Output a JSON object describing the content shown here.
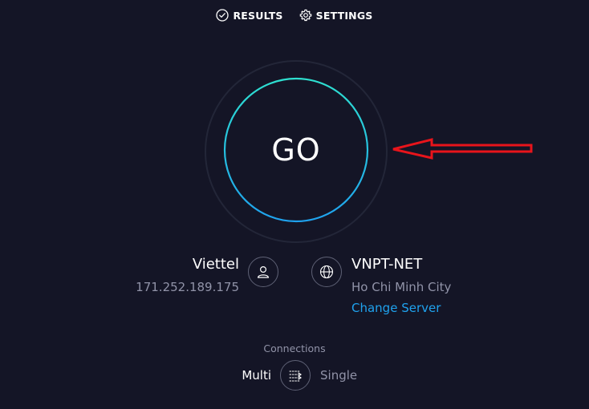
{
  "nav": {
    "results_label": "RESULTS",
    "settings_label": "SETTINGS",
    "results_icon": "check-circle-icon",
    "settings_icon": "gear-icon"
  },
  "go_button": {
    "label": "GO",
    "ring_gradient": [
      "#2ee0d0",
      "#1fa2ee"
    ]
  },
  "annotation": {
    "icon": "red-arrow-icon",
    "color": "#e8141b"
  },
  "provider": {
    "name": "Viettel",
    "ip": "171.252.189.175",
    "icon": "user-icon"
  },
  "server": {
    "name": "VNPT-NET",
    "location": "Ho Chi Minh City",
    "change_label": "Change Server",
    "icon": "globe-icon"
  },
  "connections": {
    "title": "Connections",
    "multi_label": "Multi",
    "single_label": "Single",
    "selected": "Multi",
    "toggle_icon": "connections-toggle-icon"
  },
  "colors": {
    "background": "#141526",
    "accent": "#1fa2ee",
    "muted_text": "#9193a8"
  }
}
